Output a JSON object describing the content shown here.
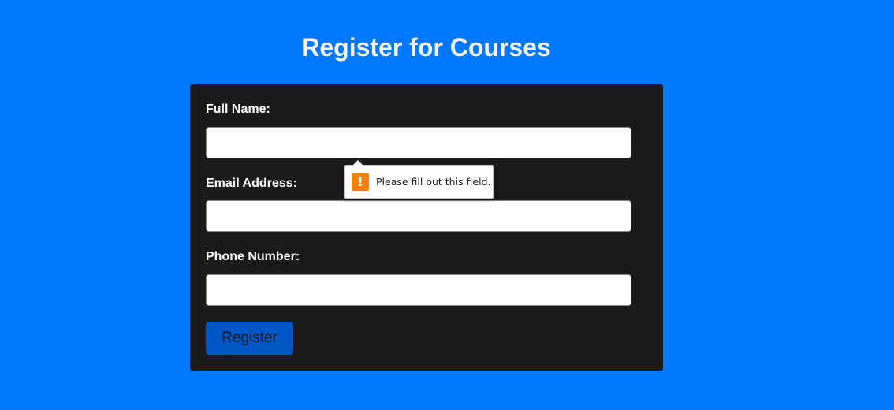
{
  "page": {
    "title": "Register for Courses",
    "background_color": "#0078ff"
  },
  "form": {
    "card_color": "#1c1a1b",
    "fields": [
      {
        "label": "Full Name:",
        "value": "",
        "placeholder": ""
      },
      {
        "label": "Email Address:",
        "value": "",
        "placeholder": ""
      },
      {
        "label": "Phone Number:",
        "value": "",
        "placeholder": ""
      }
    ],
    "submit_label": "Register",
    "submit_color": "#0056c4"
  },
  "validation_tooltip": {
    "icon": "warning-icon",
    "icon_glyph": "!",
    "icon_color": "#f57f0f",
    "message": "Please fill out this field."
  }
}
